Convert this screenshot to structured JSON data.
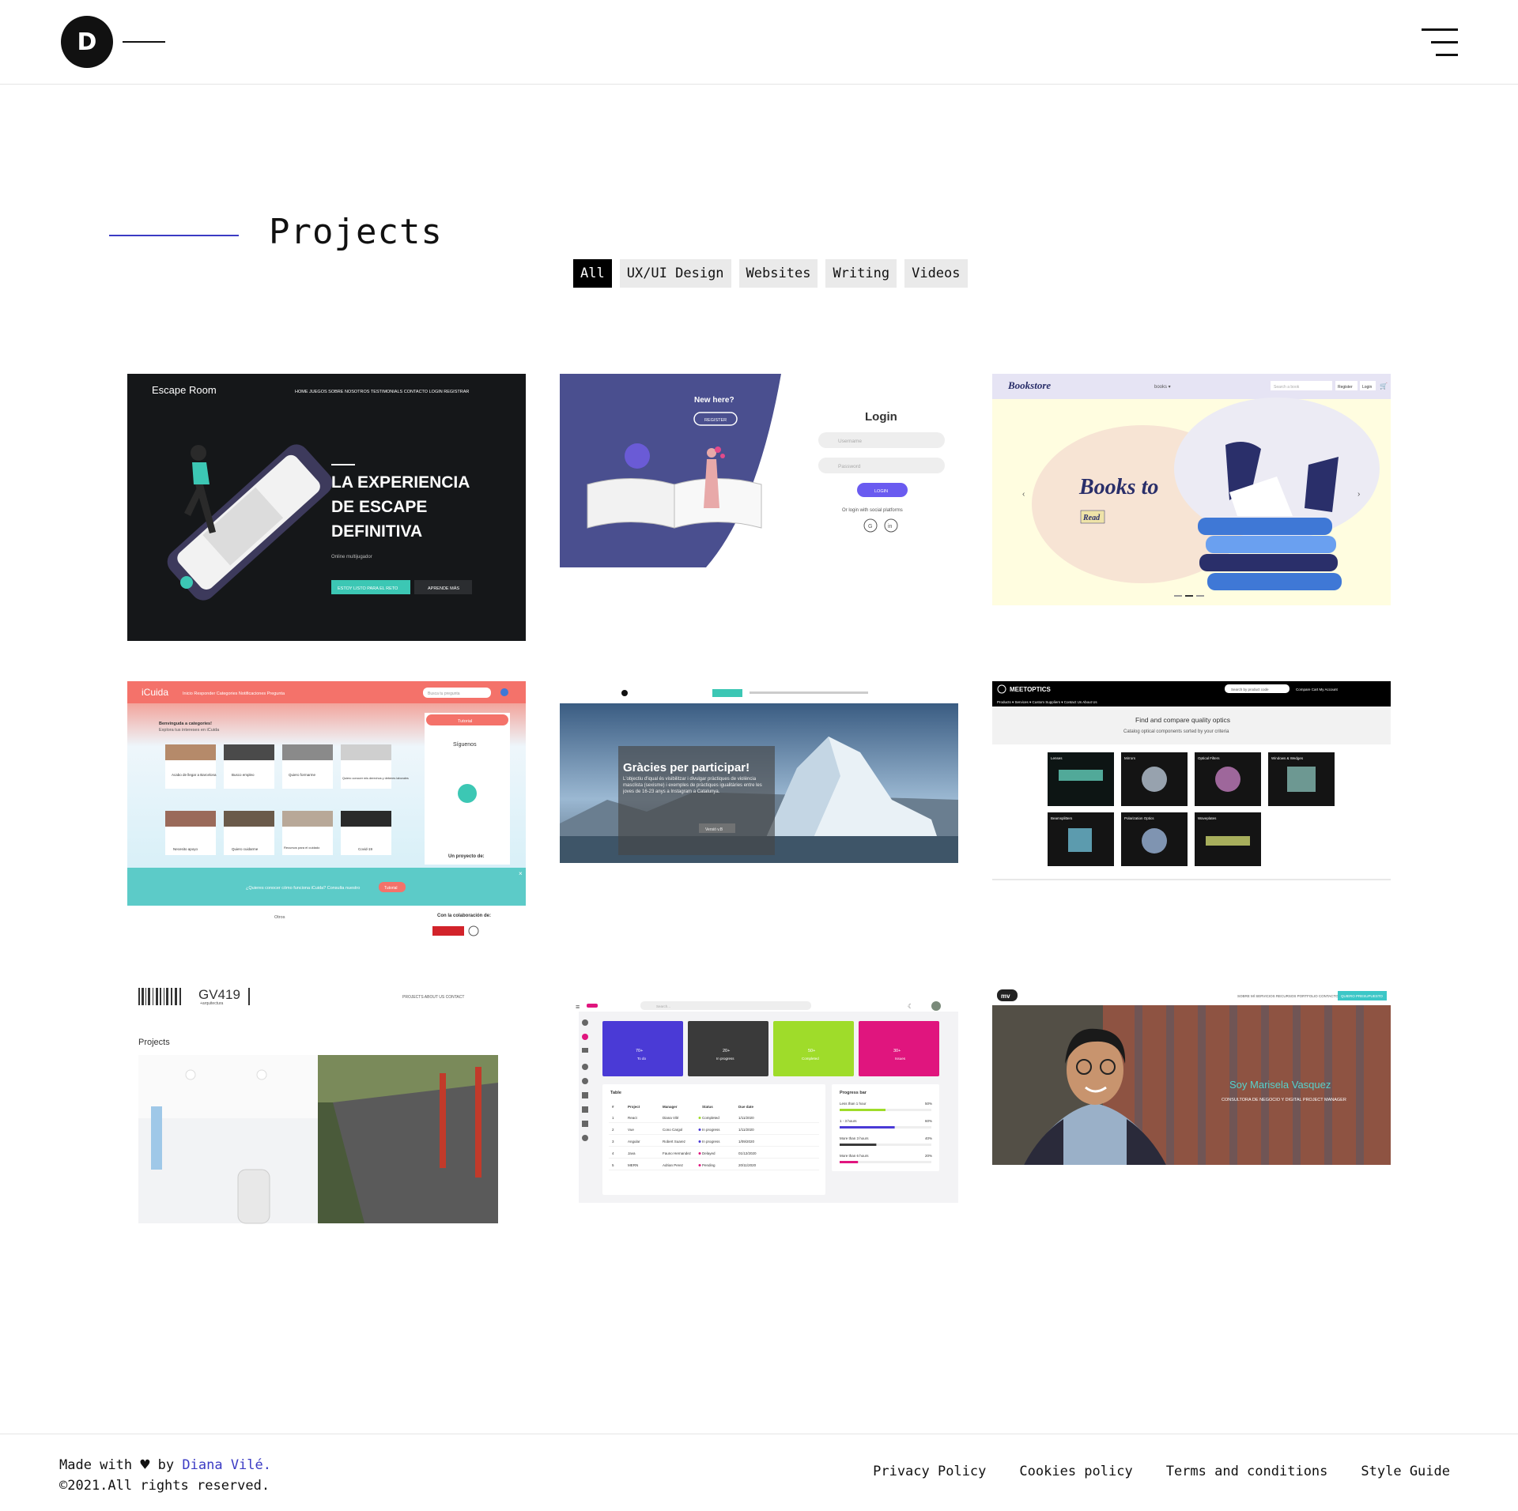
{
  "header": {
    "logo_letter": "D",
    "menu_icon": "hamburger-menu-icon"
  },
  "page": {
    "title": "Projects"
  },
  "filters": [
    "All",
    "UX/UI Design",
    "Websites",
    "Writing",
    "Videos"
  ],
  "active_filter": "All",
  "projects": {
    "escape_room": {
      "brand": "Escape Room",
      "nav": "HOME   JUEGOS   SOBRE NOSOTROS   TESTIMONIALS   CONTACTO   LOGIN   REGISTRAR",
      "headline1": "LA EXPERIENCIA",
      "headline2": "DE ESCAPE",
      "headline3": "DEFINITIVA",
      "sub": "Online multijugador",
      "cta1": "ESTOY LISTO PARA EL RETO",
      "cta2": "APRENDE MÁS"
    },
    "login": {
      "new_here": "New here?",
      "register": "REGISTER",
      "title": "Login",
      "username": "Username",
      "password": "Password",
      "button": "LOGIN",
      "social": "Or login with social platforms",
      "g": "G",
      "in": "in"
    },
    "bookstore": {
      "brand": "Bookstore",
      "menu": "books ▾",
      "search": "Search a book",
      "register": "Register",
      "login": "Login",
      "headline": "Books to",
      "tag": "Read"
    },
    "icuida": {
      "brand": "iCuida",
      "nav": "Inicio   Responder   Categories   Notificaciones   Pregunta",
      "search": "Busca tu pregunta",
      "welcome": "Benvinguda a categories!",
      "explore": "Explora tus intereses en iCuida",
      "tutorial": "Tutorial",
      "siguenos": "Síguenos",
      "cats": [
        "Acabo de llegar a Barcelona",
        "Busco empleo",
        "Quiero formarme",
        "Quiero conocer mis derechos y deberes laborales",
        "Necesito apoyo",
        "Quiero cuidarme",
        "Recursos para el cuidado",
        "Covid-19"
      ],
      "project": "Un proyecto de:",
      "banner": "¿Quieres conocer cómo funciona iCuida? Consulta nuestro",
      "banner_btn": "Tutorial",
      "otros": "Otros",
      "collab": "Con la colaboración de:"
    },
    "gracies": {
      "title": "Gràcies per participar!",
      "body": "L'objectiu d'iqual és visibilitzar i divulgar pràctiques de violència masclista (sexisme) i exemples de pràctiques igualitàries entre les joves de 16-23 anys a Instagram a Catalunya.",
      "btn": "Versió v.B"
    },
    "meetoptics": {
      "brand": "MEETOPTICS",
      "search": "Search by product code",
      "nav": "Products ▾    Services ▾    Custom Suppliers ▾    Contact Us    About Us",
      "right": "Compare   Cart   My Account",
      "headline": "Find and compare quality optics",
      "sub": "Catalog optical components sorted by your criteria",
      "tiles": [
        "Lenses",
        "Mirrors",
        "Optical Filters",
        "Windows & Wedges",
        "Beamsplitters",
        "Polarization Optics",
        "Waveplates"
      ]
    },
    "gv419": {
      "logo": "GV419",
      "logo_sub": "+arquitectura",
      "nav": "PROJECTS     ABOUT US     CONTACT",
      "heading": "Projects"
    },
    "dashboard": {
      "search": "Search...",
      "stats": [
        {
          "value": "70+",
          "label": "To do",
          "color": "#4a3ad6"
        },
        {
          "value": "20+",
          "label": "In progress",
          "color": "#3a3a3a"
        },
        {
          "value": "50+",
          "label": "Completed",
          "color": "#9fdc2a"
        },
        {
          "value": "30+",
          "label": "Issues",
          "color": "#e0157e"
        }
      ],
      "table_title": "Table",
      "cols": [
        "#",
        "Project",
        "Manager",
        "Status",
        "Due date"
      ],
      "rows": [
        [
          "1",
          "React",
          "Diana Vilé",
          "Completed",
          "1/11/2020"
        ],
        [
          "2",
          "Vue",
          "Cono Cargol",
          "In progress",
          "1/11/2020"
        ],
        [
          "3",
          "Angular",
          "Robert Suarez",
          "In progress",
          "1/09/2020"
        ],
        [
          "4",
          "Java",
          "Fauno Hernandez",
          "Delayed",
          "01/12/2020"
        ],
        [
          "5",
          "MERN",
          "Adrian Perez",
          "Pending",
          "20/11/2020"
        ]
      ],
      "progress_title": "Progress bar",
      "progress": [
        {
          "label": "Less than 1 hour",
          "value": 50,
          "pct": "50%",
          "color": "#9fdc2a"
        },
        {
          "label": "1 - 3 hours",
          "value": 60,
          "pct": "60%",
          "color": "#4a3ad6"
        },
        {
          "label": "More than 3 hours",
          "value": 40,
          "pct": "40%",
          "color": "#3a3a3a"
        },
        {
          "label": "More than 6 hours",
          "value": 20,
          "pct": "20%",
          "color": "#e0157e"
        }
      ]
    },
    "marisela": {
      "logo": "mv",
      "nav": "SOBRE MÍ   SERVICIOS   RECURSOS   PORTFOLIO   CONTACTO",
      "cta": "QUIERO PRESUPUESTO",
      "name": "Soy Marisela Vasquez",
      "role": "CONSULTORA DE NEGOCIO Y DIGITAL PROJECT MANAGER"
    }
  },
  "footer": {
    "made_with": "Made with",
    "by": "by",
    "author": "Diana Vilé.",
    "rights": "©2021.All rights reserved.",
    "links": [
      "Privacy Policy",
      "Cookies policy",
      "Terms and conditions",
      "Style Guide"
    ]
  },
  "colors": {
    "accent": "#3b3bc4",
    "teal": "#3cc7b4",
    "coral": "#f16b6b"
  }
}
